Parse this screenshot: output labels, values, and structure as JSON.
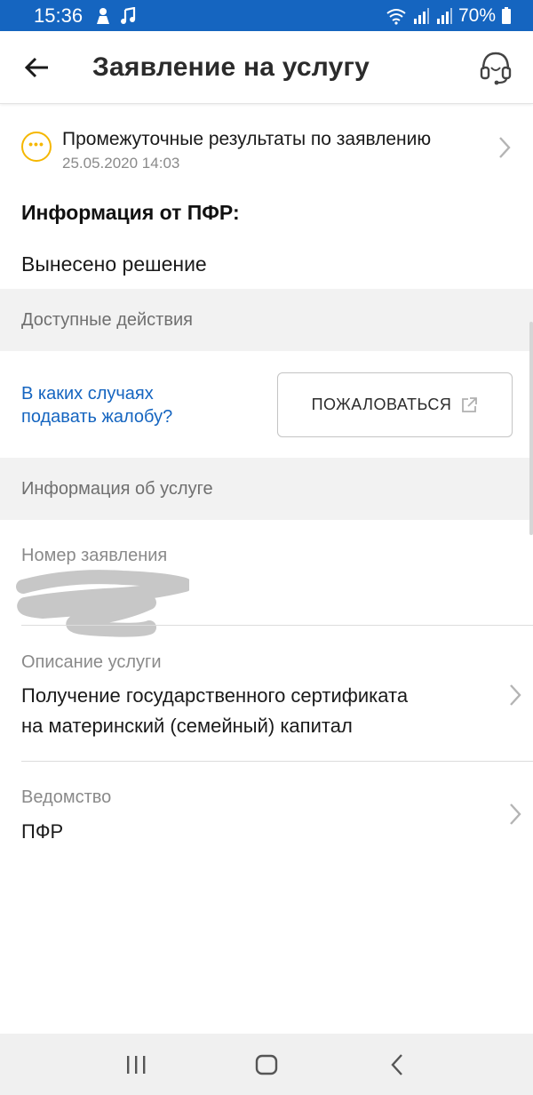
{
  "status_bar": {
    "time": "15:36",
    "battery": "70%",
    "left_icons": [
      "person-icon",
      "music-note-icon"
    ],
    "right_icons": [
      "wifi-icon",
      "signal-icon",
      "signal-icon",
      "battery-icon"
    ]
  },
  "app_bar": {
    "title": "Заявление на услугу",
    "left_icon": "back-arrow-icon",
    "right_icon": "support-headset-icon"
  },
  "notification": {
    "title": "Промежуточные результаты по заявлению",
    "date": "25.05.2020 14:03",
    "icon": "more-dots-icon"
  },
  "pfr_info": {
    "heading": "Информация от ПФР:",
    "value": "Вынесено решение"
  },
  "actions": {
    "header": "Доступные действия",
    "help_link_line1": "В каких случаях",
    "help_link_line2": "подавать жалобу?",
    "complain_button": "ПОЖАЛОВАТЬСЯ"
  },
  "service_info": {
    "header": "Информация об услуге",
    "number_label": "Номер заявления",
    "description_label": "Описание услуги",
    "description_line1": "Получение государственного сертификата",
    "description_line2": "на материнский (семейный) капитал",
    "agency_label": "Ведомство",
    "agency_value": "ПФР"
  },
  "colors": {
    "status_bar": "#1565c0",
    "link": "#1565c0",
    "notification_icon": "#f5b700",
    "section_bg": "#f2f2f2"
  }
}
